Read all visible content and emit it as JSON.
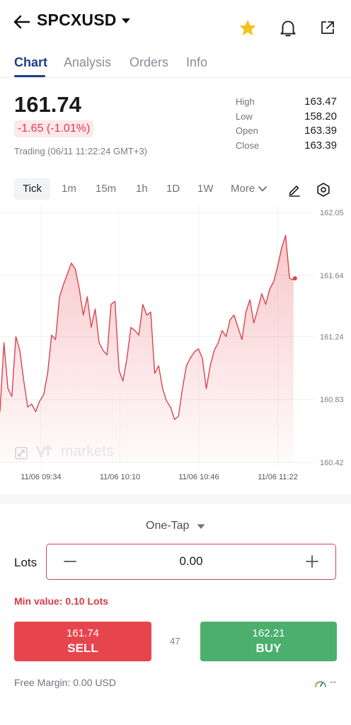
{
  "header": {
    "symbol": "SPCXUSD"
  },
  "tabs": [
    {
      "label": "Chart",
      "active": true
    },
    {
      "label": "Analysis",
      "active": false
    },
    {
      "label": "Orders",
      "active": false
    },
    {
      "label": "Info",
      "active": false
    }
  ],
  "quote": {
    "price": "161.74",
    "change": "-1.65 (-1.01%)",
    "status": "Trading (06/11 11:22:24 GMT+3)",
    "stats": [
      {
        "label": "High",
        "value": "163.47"
      },
      {
        "label": "Low",
        "value": "158.20"
      },
      {
        "label": "Open",
        "value": "163.39"
      },
      {
        "label": "Close",
        "value": "163.39"
      }
    ]
  },
  "intervals": [
    "Tick",
    "1m",
    "15m",
    "1h",
    "1D",
    "1W",
    "More"
  ],
  "chart_data": {
    "type": "area",
    "y_ticks": [
      "162.05",
      "161.64",
      "161.24",
      "160.83",
      "160.42"
    ],
    "ylim": [
      160.42,
      162.05
    ],
    "x_ticks": [
      "11/06 09:34",
      "11/06 10:10",
      "11/06 10:46",
      "11/06 11:22"
    ],
    "x_tick_positions": [
      0.13,
      0.38,
      0.63,
      0.88
    ],
    "x": [
      0.0,
      0.01,
      0.03,
      0.04,
      0.05,
      0.06,
      0.07,
      0.08,
      0.09,
      0.1,
      0.11,
      0.12,
      0.13,
      0.14,
      0.15,
      0.16,
      0.17,
      0.18,
      0.19,
      0.2,
      0.21,
      0.22,
      0.23,
      0.24,
      0.25,
      0.26,
      0.27,
      0.28,
      0.29,
      0.3,
      0.31,
      0.32,
      0.33,
      0.34,
      0.35,
      0.36,
      0.37,
      0.38,
      0.39,
      0.4,
      0.41,
      0.42,
      0.43,
      0.44,
      0.45,
      0.46,
      0.47,
      0.48,
      0.49,
      0.5,
      0.51,
      0.52,
      0.53,
      0.54,
      0.55,
      0.56,
      0.57,
      0.58,
      0.59,
      0.6,
      0.61,
      0.62,
      0.63,
      0.64,
      0.65,
      0.66,
      0.67,
      0.68,
      0.69,
      0.7,
      0.71,
      0.72,
      0.73,
      0.74,
      0.75,
      0.76,
      0.77,
      0.78,
      0.79,
      0.8,
      0.81,
      0.82,
      0.83,
      0.84,
      0.85,
      0.86,
      0.87,
      0.88,
      0.89,
      0.9,
      0.91
    ],
    "values": [
      160.75,
      161.2,
      160.9,
      160.85,
      161.24,
      161.15,
      160.95,
      160.78,
      160.8,
      160.75,
      160.82,
      160.86,
      161.0,
      161.25,
      161.22,
      161.5,
      161.58,
      161.65,
      161.72,
      161.68,
      161.55,
      161.38,
      161.5,
      161.3,
      161.42,
      161.2,
      161.15,
      161.12,
      161.45,
      161.47,
      161.02,
      160.95,
      161.1,
      161.3,
      161.28,
      161.25,
      161.45,
      161.38,
      161.4,
      161.0,
      161.05,
      160.9,
      160.82,
      160.78,
      160.7,
      160.72,
      160.9,
      161.05,
      161.1,
      161.14,
      161.16,
      161.1,
      160.9,
      161.05,
      161.15,
      161.2,
      161.28,
      161.24,
      161.35,
      161.38,
      161.3,
      161.22,
      161.4,
      161.48,
      161.33,
      161.42,
      161.52,
      161.45,
      161.55,
      161.6,
      161.7,
      161.82,
      161.9,
      161.62,
      161.61
    ],
    "last_value": 161.62
  },
  "chart_watermark": "markets",
  "trade": {
    "mode": "One-Tap",
    "lots_label": "Lots",
    "lots_value": "0.00",
    "min_value": "Min value: 0.10 Lots",
    "sell_price": "161.74",
    "sell_label": "SELL",
    "buy_price": "162.21",
    "buy_label": "BUY",
    "spread": "47",
    "free_margin": "Free Margin: 0.00 USD",
    "gauge_value": "--"
  },
  "colors": {
    "accent": "#1f3d8a",
    "sell": "#e7454d",
    "buy": "#4caf6d",
    "line": "#d9454c"
  }
}
